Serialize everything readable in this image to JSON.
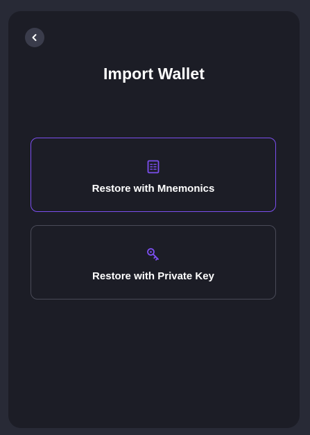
{
  "header": {
    "title": "Import Wallet",
    "back_icon": "chevron-left-icon"
  },
  "options": [
    {
      "label": "Restore with Mnemonics",
      "icon": "document-list-icon",
      "selected": true
    },
    {
      "label": "Restore with Private Key",
      "icon": "key-icon",
      "selected": false
    }
  ],
  "colors": {
    "accent": "#7c4ff0",
    "background": "#1c1d26",
    "border": "#4a4b58"
  }
}
